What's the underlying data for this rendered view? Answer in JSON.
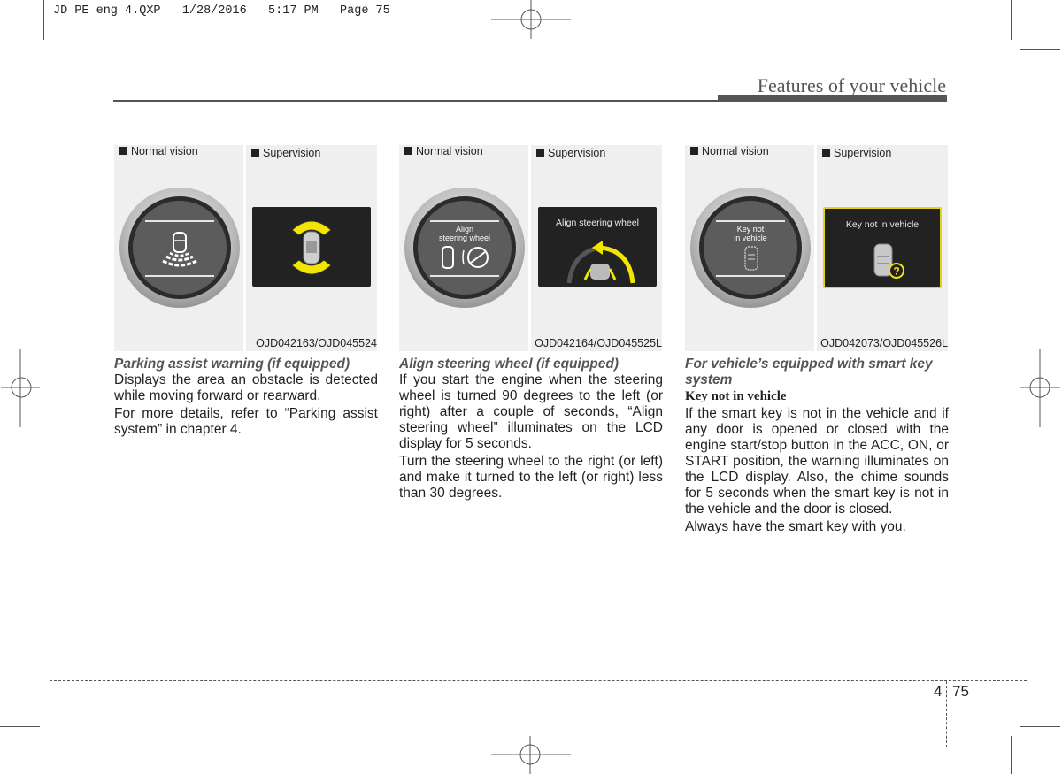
{
  "slug": "JD PE eng 4.QXP   1/28/2016   5:17 PM   Page 75",
  "header": {
    "title": "Features of your vehicle"
  },
  "figures": [
    {
      "normal_label": "Normal vision",
      "super_label": "Supervision",
      "code": "OJD042163/OJD045524",
      "gauge_text": "",
      "lcd_text": "",
      "icon": "parking-sensor"
    },
    {
      "normal_label": "Normal vision",
      "super_label": "Supervision",
      "code": "OJD042164/OJD045525L",
      "gauge_text_1": "Align",
      "gauge_text_2": "steering wheel",
      "lcd_text": "Align steering wheel",
      "icon": "steering-wheel"
    },
    {
      "normal_label": "Normal vision",
      "super_label": "Supervision",
      "code": "OJD042073/OJD045526L",
      "gauge_text_1": "Key not",
      "gauge_text_2": "in vehicle",
      "lcd_text": "Key not in vehicle",
      "icon": "smart-key"
    }
  ],
  "colors": {
    "warning_yellow": "#f2e600",
    "lcd_bg": "#222222",
    "gauge_face": "#5c5c5c"
  },
  "sections": [
    {
      "heading": "Parking assist warning (if equipped)",
      "paragraphs": [
        "Displays the area an obstacle is detected while moving forward or rearward.",
        "For more details, refer to “Parking assist system” in chapter 4."
      ]
    },
    {
      "heading": "Align steering wheel (if equipped)",
      "paragraphs": [
        "If you start the engine when the steering wheel is turned 90 degrees to the left (or right) after a couple of seconds, “Align steering wheel” illuminates on the LCD display for 5 seconds.",
        "Turn the steering wheel to the right (or left) and make it turned to the left (or right) less than 30 degrees."
      ]
    },
    {
      "heading": "For vehicle’s equipped with smart key system",
      "subheading": "Key not in vehicle",
      "paragraphs": [
        "If the smart key is not in the vehicle and if any door is opened or closed with the engine start/stop button in the ACC, ON, or START position, the warning illuminates on the LCD display. Also, the chime sounds for 5 seconds when the smart key is not in the vehicle and the door is closed.",
        "Always have the smart key with you."
      ]
    }
  ],
  "footer": {
    "chapter": "4",
    "page": "75"
  }
}
